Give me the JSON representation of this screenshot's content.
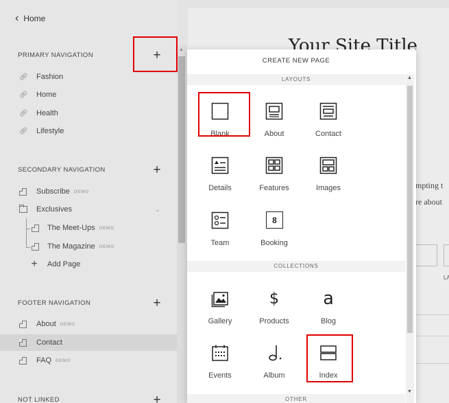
{
  "sidebar": {
    "home_label": "Home",
    "primary": {
      "title": "PRIMARY NAVIGATION",
      "items": [
        "Fashion",
        "Home",
        "Health",
        "Lifestyle"
      ]
    },
    "secondary": {
      "title": "SECONDARY NAVIGATION",
      "subscribe": "Subscribe",
      "exclusives": "Exclusives",
      "meetups": "The Meet-Ups",
      "magazine": "The Magazine",
      "add_page": "Add Page"
    },
    "footer": {
      "title": "FOOTER NAVIGATION",
      "about": "About",
      "contact": "Contact",
      "faq": "FAQ"
    },
    "not_linked": {
      "title": "NOT LINKED"
    },
    "badge": "DEMO"
  },
  "preview": {
    "site_title": "Your Site Title",
    "text1": "mpting t",
    "text2": "re about",
    "la": "LA"
  },
  "modal": {
    "title": "CREATE NEW PAGE",
    "layouts_label": "LAYOUTS",
    "collections_label": "COLLECTIONS",
    "other_label": "OTHER",
    "layouts": [
      "Blank",
      "About",
      "Contact",
      "Details",
      "Features",
      "Images",
      "Team",
      "Booking"
    ],
    "collections": [
      "Gallery",
      "Products",
      "Blog",
      "Events",
      "Album",
      "Index"
    ],
    "booking_number": "8",
    "products_symbol": "$",
    "blog_symbol": "a"
  },
  "colors": {
    "highlight": "#e00000",
    "selected_row": "#d5d5d5"
  }
}
